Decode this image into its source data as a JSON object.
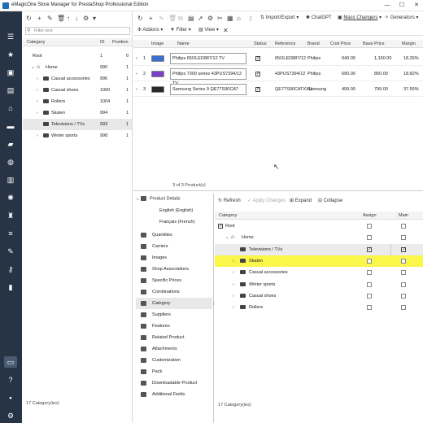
{
  "window": {
    "title": "eMagicOne Store Manager for PrestaShop Professional Edition",
    "minimize": "—",
    "maximize": "☐",
    "close": "✕"
  },
  "sidebar": {
    "icons": [
      "menu-icon",
      "star-icon",
      "inbox-icon",
      "box-icon",
      "cart-icon",
      "chat-icon",
      "truck-icon",
      "globe-icon",
      "chart-icon",
      "openai-icon",
      "puzzle-icon",
      "sliders-icon",
      "wrench-icon",
      "book-icon",
      "inbox2-icon",
      "help-icon",
      "lock-icon",
      "gear-icon"
    ]
  },
  "left": {
    "filter_placeholder": "Filter text",
    "headers": {
      "category": "Category",
      "id": "ID",
      "position": "Position"
    },
    "rows": [
      {
        "name": "Root",
        "id": "1",
        "pos": "0",
        "level": 0,
        "arrow": "",
        "folder": false
      },
      {
        "name": "Home",
        "id": "990",
        "pos": "1",
        "level": 1,
        "arrow": "⌄",
        "folder": false
      },
      {
        "name": "Casual accessories",
        "id": "996",
        "pos": "1",
        "level": 2,
        "arrow": "›",
        "folder": true
      },
      {
        "name": "Casual shoes",
        "id": "1000",
        "pos": "1",
        "level": 2,
        "arrow": "›",
        "folder": true
      },
      {
        "name": "Rollers",
        "id": "1004",
        "pos": "1",
        "level": 2,
        "arrow": "›",
        "folder": true
      },
      {
        "name": "Skaten",
        "id": "994",
        "pos": "1",
        "level": 2,
        "arrow": "›",
        "folder": true
      },
      {
        "name": "Televisions / TVs",
        "id": "993",
        "pos": "1",
        "level": 2,
        "arrow": "",
        "folder": true,
        "selected": true
      },
      {
        "name": "Winter sports",
        "id": "998",
        "pos": "1",
        "level": 2,
        "arrow": "›",
        "folder": true
      }
    ],
    "status": "17 Category(ies)"
  },
  "toolbar": {
    "addons": "Addons",
    "filter": "Filter",
    "view": "View",
    "import_export": "Import/Export",
    "chatgpt": "ChatGPT",
    "mass_changers": "Mass Changers",
    "generators": "Generators"
  },
  "grid": {
    "headers": {
      "image": "Image",
      "name": "Name",
      "status": "Status",
      "reference": "Reference",
      "brand": "Brand",
      "cost": "Cost Price",
      "base": "Base Price",
      "margin": "Margin"
    },
    "rows": [
      {
        "n": "1",
        "name": "Philips 65OLED887/12 TV",
        "reference": "65OLED887/12",
        "brand": "Philips",
        "cost": "940.00",
        "base": "1,150.00",
        "margin": "18.26%",
        "color": "#3a6fd0"
      },
      {
        "n": "2",
        "name": "Philips 7300 series 43PUS7394/12 TV",
        "reference": "43PUS7394/12",
        "brand": "Philips",
        "cost": "690.00",
        "base": "850.00",
        "margin": "18.82%",
        "color": "#7a3fc8"
      },
      {
        "n": "3",
        "name": "Samsung Series 9 QE77S90CAT",
        "reference": "QE77S90CATXXU",
        "brand": "Samsung",
        "cost": "499.00",
        "base": "799.00",
        "margin": "37.55%",
        "color": "#2a2a2a"
      }
    ],
    "status": "3 of 3 Product(s)"
  },
  "details": {
    "header": "Product Details",
    "lang_en": "English (English)",
    "lang_fr": "Français (French)",
    "items": [
      "Quantities",
      "Carriers",
      "Images",
      "Shop Associations",
      "Specific Prices",
      "Combinations",
      "Category",
      "Suppliers",
      "Features",
      "Related Product",
      "Attachments",
      "Customization",
      "Pack",
      "Downloadable Product",
      "Additional Fields"
    ],
    "active": "Category"
  },
  "cattree": {
    "refresh": "Refresh",
    "apply": "Apply Changes",
    "expand": "Expand",
    "collapse": "Collapse",
    "headers": {
      "category": "Category",
      "assign": "Assign",
      "main": "Main"
    },
    "rows": [
      {
        "name": "Root",
        "level": 0,
        "arrow": "",
        "folder": false,
        "assign": false,
        "main": false,
        "rootchk": true
      },
      {
        "name": "Home",
        "level": 1,
        "arrow": "⌄",
        "folder": false,
        "home": true,
        "assign": false,
        "main": false
      },
      {
        "name": "Televisions / TVs",
        "level": 2,
        "arrow": "",
        "folder": true,
        "assign": true,
        "main": true,
        "shaded": true
      },
      {
        "name": "Skaten",
        "level": 2,
        "arrow": "›",
        "folder": true,
        "assign": false,
        "main": false,
        "highlight": true
      },
      {
        "name": "Casual accessories",
        "level": 2,
        "arrow": "›",
        "folder": true,
        "assign": false,
        "main": false
      },
      {
        "name": "Winter sports",
        "level": 2,
        "arrow": "›",
        "folder": true,
        "assign": false,
        "main": false
      },
      {
        "name": "Casual shoes",
        "level": 2,
        "arrow": "›",
        "folder": true,
        "assign": false,
        "main": false
      },
      {
        "name": "Rollers",
        "level": 2,
        "arrow": "›",
        "folder": true,
        "assign": false,
        "main": false
      }
    ],
    "status": "17 Category(ies)"
  },
  "colors": {
    "sidebar": "#273446",
    "highlight": "#fbf64a",
    "selected": "#e8e8e8"
  }
}
